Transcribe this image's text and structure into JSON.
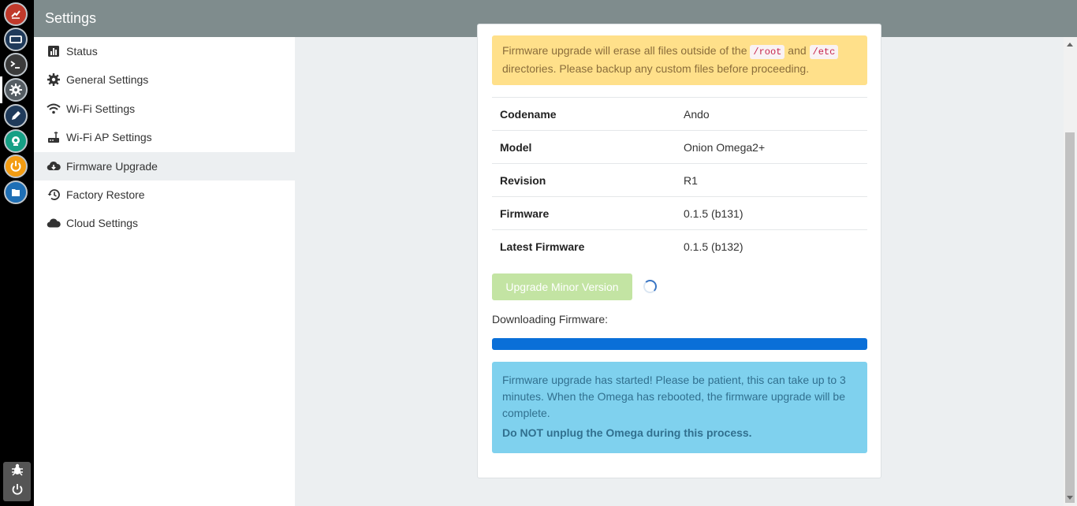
{
  "app": {
    "title": "Settings"
  },
  "dock": {
    "icons": [
      {
        "name": "onion-app-icon",
        "color": "#c0392b"
      },
      {
        "name": "window-icon",
        "color": "#1f3a5a"
      },
      {
        "name": "terminal-icon",
        "color": "#3b3b3b"
      },
      {
        "name": "settings-icon",
        "color": "#555d63"
      },
      {
        "name": "editor-icon",
        "color": "#1f3a5a"
      },
      {
        "name": "webcam-icon",
        "color": "#16a085"
      },
      {
        "name": "power-icon",
        "color": "#f39c12"
      },
      {
        "name": "files-icon",
        "color": "#1f6fb5"
      }
    ],
    "bottom": [
      "bug-icon",
      "power-icon"
    ]
  },
  "sidebar": {
    "items": [
      {
        "label": "Status",
        "icon": "bar-chart-icon"
      },
      {
        "label": "General Settings",
        "icon": "gear-icon"
      },
      {
        "label": "Wi-Fi Settings",
        "icon": "wifi-icon"
      },
      {
        "label": "Wi-Fi AP Settings",
        "icon": "router-icon"
      },
      {
        "label": "Firmware Upgrade",
        "icon": "cloud-download-icon",
        "active": true
      },
      {
        "label": "Factory Restore",
        "icon": "history-icon"
      },
      {
        "label": "Cloud Settings",
        "icon": "cloud-icon"
      }
    ]
  },
  "main": {
    "warning": {
      "text_before": "Firmware upgrade will erase all files outside of the",
      "code1": "/root",
      "and": "and",
      "code2": "/etc",
      "text_after": "directories. Please backup any custom files before proceeding."
    },
    "info_rows": [
      {
        "key": "Codename",
        "value": "Ando"
      },
      {
        "key": "Model",
        "value": "Onion Omega2+"
      },
      {
        "key": "Revision",
        "value": "R1"
      },
      {
        "key": "Firmware",
        "value": "0.1.5 (b131)"
      },
      {
        "key": "Latest Firmware",
        "value": "0.1.5 (b132)"
      }
    ],
    "upgrade_button": "Upgrade Minor Version",
    "download_label": "Downloading Firmware:",
    "download_progress": 1.0,
    "info_message": "Firmware upgrade has started! Please be patient, this can take up to 3 minutes. When the Omega has rebooted, the firmware upgrade will be complete.",
    "info_warning": "Do NOT unplug the Omega during this process."
  },
  "colors": {
    "header": "#7f8c8d",
    "warning_bg": "#ffe08a",
    "info_bg": "#7fd1ee",
    "progress": "#0a6fd8",
    "button_disabled": "#c3e4a3"
  }
}
